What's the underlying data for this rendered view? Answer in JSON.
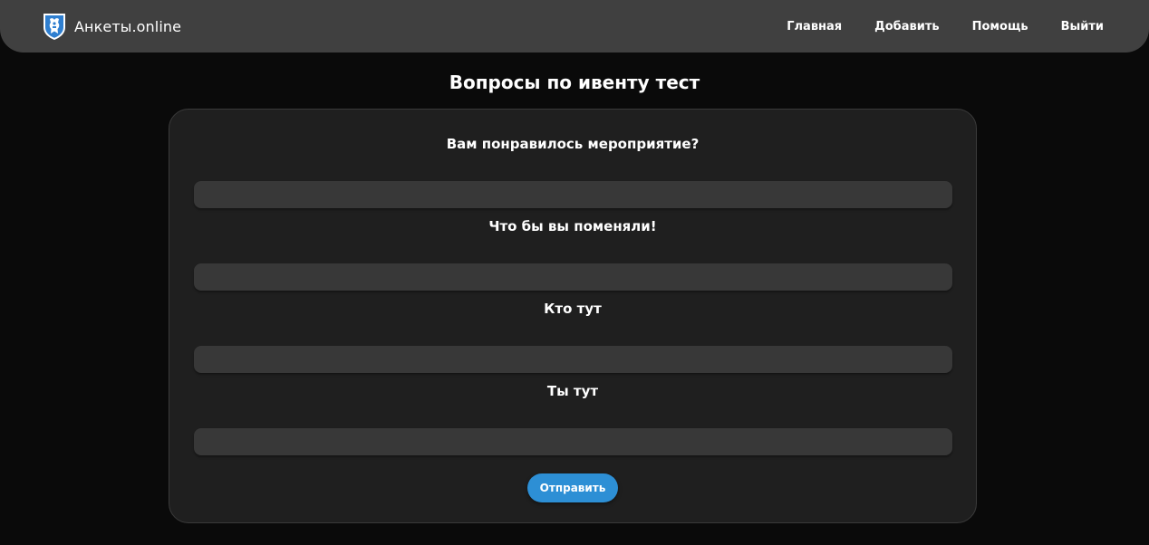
{
  "navbar": {
    "brand": {
      "name": "Анкеты.online",
      "logo_icon": "shield-crest-icon"
    },
    "links": [
      {
        "label": "Главная"
      },
      {
        "label": "Добавить"
      },
      {
        "label": "Помощь"
      },
      {
        "label": "Выйти"
      }
    ]
  },
  "page": {
    "title": "Вопросы по ивенту тест"
  },
  "form": {
    "questions": [
      {
        "label": "Вам понравилось мероприятие?",
        "value": "",
        "placeholder": ""
      },
      {
        "label": "Что бы вы поменяли!",
        "value": "",
        "placeholder": ""
      },
      {
        "label": "Кто тут",
        "value": "",
        "placeholder": ""
      },
      {
        "label": "Ты тут",
        "value": "",
        "placeholder": ""
      }
    ],
    "submit_label": "Отправить"
  },
  "colors": {
    "page_background": "#0a0a0a",
    "navbar_background": "#404040",
    "card_background": "#1f1f1f",
    "input_background": "#383838",
    "accent": "#2d8fd5",
    "text": "#ffffff"
  }
}
